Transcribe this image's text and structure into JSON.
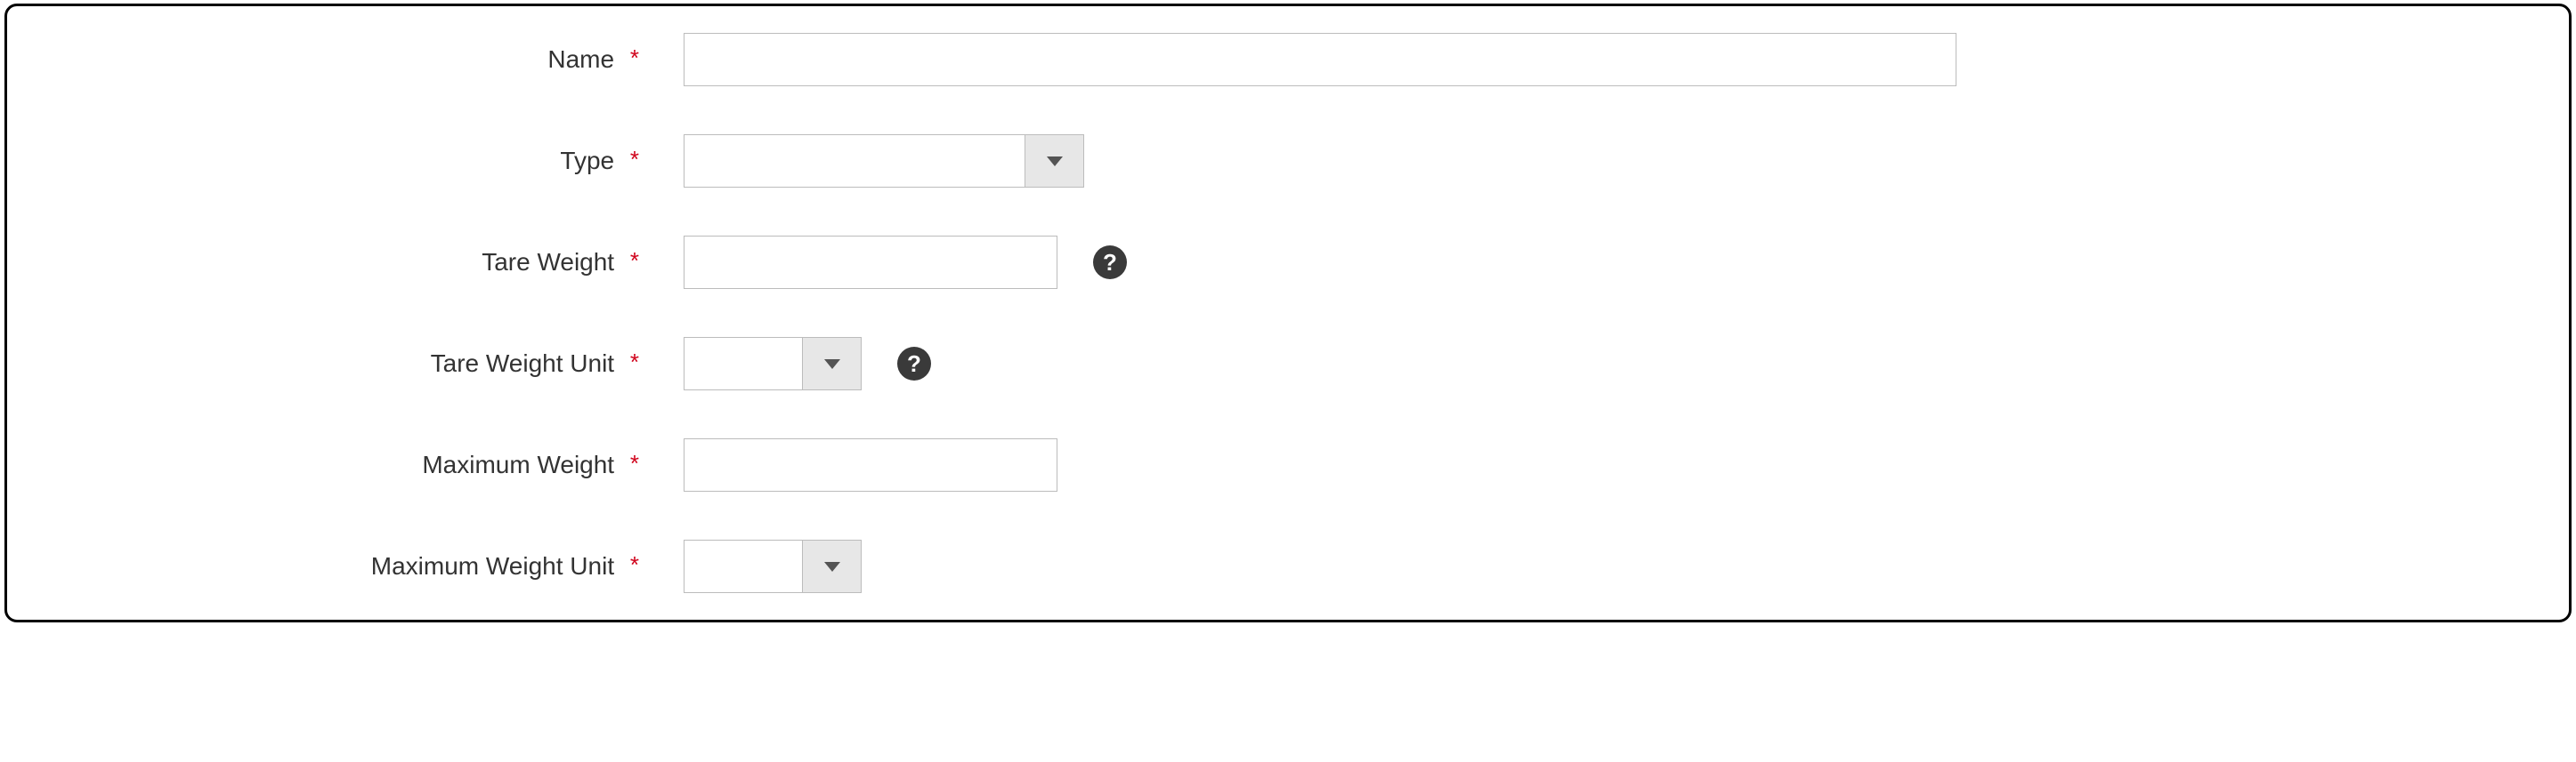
{
  "fields": {
    "name": {
      "label": "Name",
      "value": ""
    },
    "type": {
      "label": "Type",
      "value": ""
    },
    "tare_weight": {
      "label": "Tare Weight",
      "value": ""
    },
    "tare_weight_unit": {
      "label": "Tare Weight Unit",
      "value": ""
    },
    "maximum_weight": {
      "label": "Maximum Weight",
      "value": ""
    },
    "maximum_weight_unit": {
      "label": "Maximum Weight Unit",
      "value": ""
    }
  },
  "required_mark": "*",
  "help_glyph": "?"
}
